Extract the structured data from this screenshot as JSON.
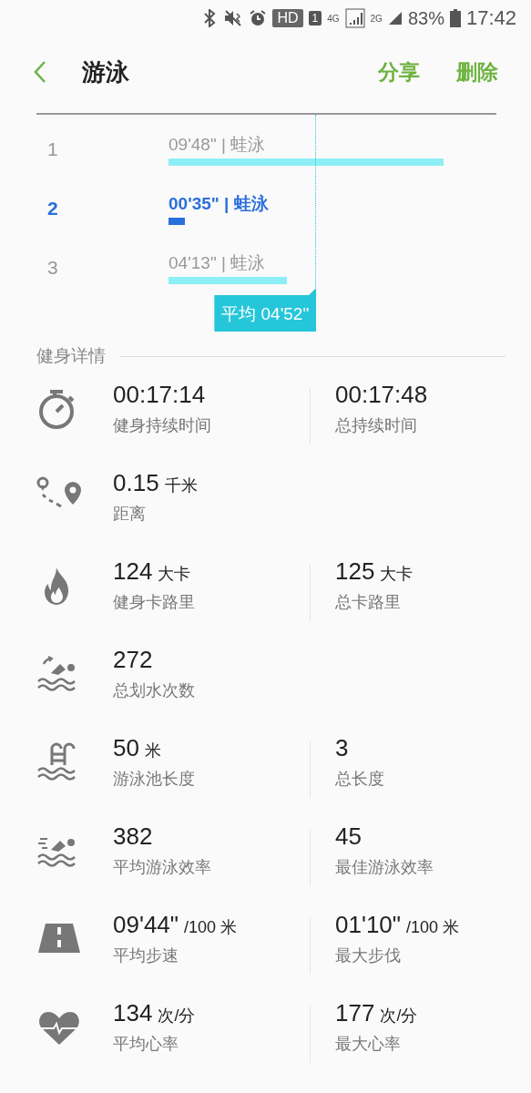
{
  "status_bar": {
    "badges": [
      "HD",
      "1"
    ],
    "network": [
      "4G",
      "2G"
    ],
    "battery": "83%",
    "time": "17:42"
  },
  "app_bar": {
    "title": "游泳",
    "actions": [
      "分享",
      "删除"
    ]
  },
  "laps": {
    "items": [
      {
        "number": "1",
        "time": "09'48\" | 蛙泳",
        "selected": false
      },
      {
        "number": "2",
        "time": "00'35\" | 蛙泳",
        "selected": true
      },
      {
        "number": "3",
        "time": "04'13\" | 蛙泳",
        "selected": false
      }
    ],
    "average": {
      "label": "平均 04'52\""
    }
  },
  "section": {
    "title": "健身详情"
  },
  "stats": [
    {
      "cells": [
        {
          "value": "00:17:14",
          "label": "健身持续时间"
        },
        {
          "value": "00:17:48",
          "label": "总持续时间"
        }
      ]
    },
    {
      "cells": [
        {
          "value": "0.15",
          "unit": "千米",
          "label": "距离"
        }
      ]
    },
    {
      "cells": [
        {
          "value": "124",
          "unit": "大卡",
          "label": "健身卡路里"
        },
        {
          "value": "125",
          "unit": "大卡",
          "label": "总卡路里"
        }
      ]
    },
    {
      "cells": [
        {
          "value": "272",
          "label": "总划水次数"
        }
      ]
    },
    {
      "cells": [
        {
          "value": "50",
          "unit": "米",
          "label": "游泳池长度"
        },
        {
          "value": "3",
          "label": "总长度"
        }
      ]
    },
    {
      "cells": [
        {
          "value": "382",
          "label": "平均游泳效率"
        },
        {
          "value": "45",
          "label": "最佳游泳效率"
        }
      ]
    },
    {
      "cells": [
        {
          "value": "09'44\"",
          "unit": "/100 米",
          "label": "平均步速"
        },
        {
          "value": "01'10\"",
          "unit": "/100 米",
          "label": "最大步伐"
        }
      ]
    },
    {
      "cells": [
        {
          "value": "134",
          "unit": "次/分",
          "label": "平均心率"
        },
        {
          "value": "177",
          "unit": "次/分",
          "label": "最大心率"
        }
      ]
    }
  ]
}
